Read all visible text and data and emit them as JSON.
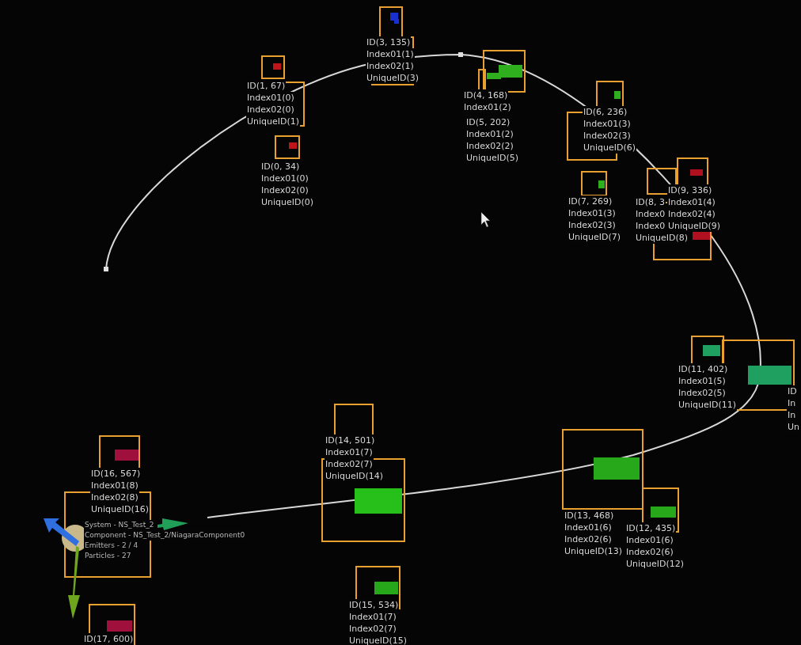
{
  "particles": [
    {
      "color": "#c0141c",
      "label": [
        "ID(1, 67)",
        "Index01(0)",
        "Index02(0)",
        "UniqueID(1)"
      ]
    },
    {
      "color": "#c0141c",
      "label": [
        "ID(0, 34)",
        "Index01(0)",
        "Index02(0)",
        "UniqueID(0)"
      ]
    },
    {
      "color": "#1a2fd0"
    },
    {
      "color": "#1a2fd0",
      "label": [
        "ID(3, 135)",
        "Index01(1)",
        "Index02(1)",
        "UniqueID(3)"
      ]
    },
    {
      "color": "#2fae1e",
      "label": [
        "ID(4, 168)",
        "Index01(2)"
      ]
    },
    {
      "color": "#2fae1e",
      "label": [
        "ID(5, 202)",
        "Index01(2)",
        "Index02(2)",
        "UniqueID(5)"
      ]
    },
    {
      "color": "#2fae1e",
      "label": [
        "ID(6, 236)",
        "Index01(3)",
        "Index02(3)",
        "UniqueID(6)"
      ]
    },
    {
      "color": "#2fae1e",
      "label": [
        "ID(7, 269)",
        "Index01(3)",
        "Index02(3)",
        "UniqueID(7)"
      ]
    },
    {
      "color": "#b01020",
      "label": [
        "ID(8, 3",
        "Index0",
        "Index0",
        "UniqueID(8)"
      ]
    },
    {
      "color": "#b01020",
      "label": [
        "ID(9, 336)",
        "Index01(4)",
        "Index02(4)",
        "UniqueID(9)"
      ]
    },
    {
      "color": "#1fa060",
      "label": [
        "ID",
        "In",
        "In",
        "Un"
      ]
    },
    {
      "color": "#1fa060",
      "label": [
        "ID(11, 402)",
        "Index01(5)",
        "Index02(5)",
        "UniqueID(11)"
      ]
    },
    {
      "color": "#27a81a",
      "label": [
        "ID(12, 435)",
        "Index01(6)",
        "Index02(6)",
        "UniqueID(12)"
      ]
    },
    {
      "color": "#27a81a",
      "label": [
        "ID(13, 468)",
        "Index01(6)",
        "Index02(6)",
        "UniqueID(13)"
      ]
    },
    {
      "color": "#27c01a",
      "label": [
        "ID(14, 501)",
        "Index01(7)",
        "Index02(7)",
        "UniqueID(14)"
      ]
    },
    {
      "color": "#27a81a",
      "label": [
        "ID(15, 534)",
        "Index01(7)",
        "Index02(7)",
        "UniqueID(15)"
      ]
    },
    {
      "color": "#a0103c",
      "label": [
        "ID(16, 567)",
        "Index01(8)",
        "Index02(8)",
        "UniqueID(16)"
      ]
    },
    {
      "color": "#a0103c",
      "label": [
        "ID(17, 600)"
      ]
    }
  ],
  "component_info": [
    "System - NS_Test_2",
    "Component - NS_Test_2/NiagaraComponent0",
    "Emitters - 2 / 4",
    "Particles - 27"
  ]
}
